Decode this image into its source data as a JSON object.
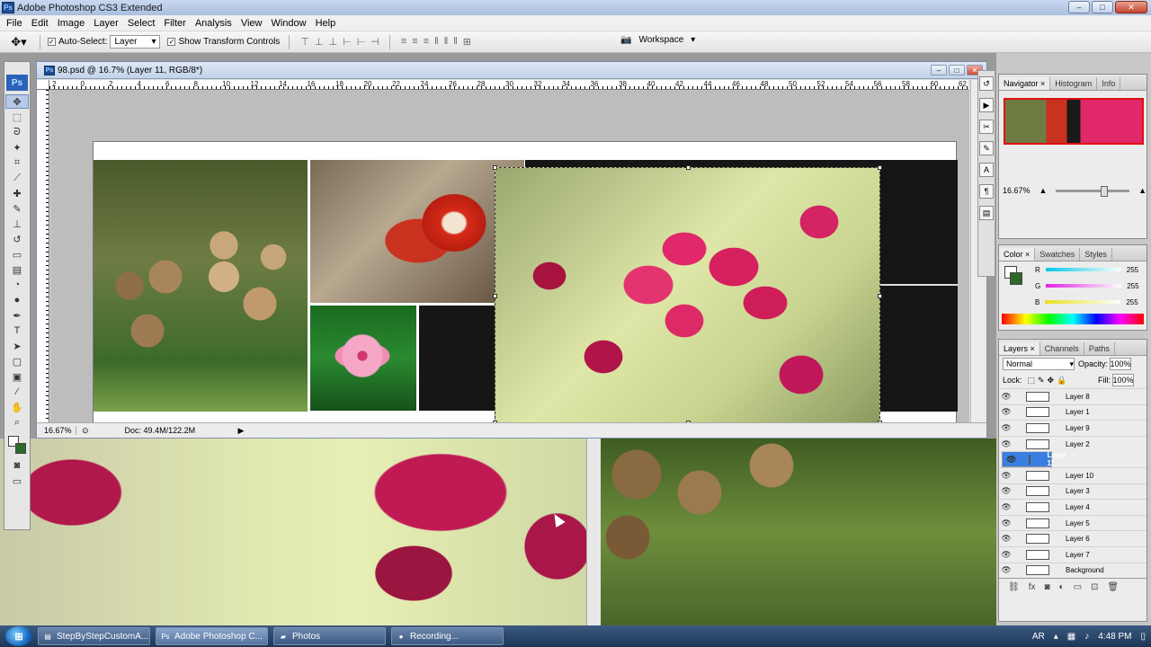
{
  "app": {
    "title": "Adobe Photoshop CS3 Extended",
    "logo": "Ps"
  },
  "menu": [
    "File",
    "Edit",
    "Image",
    "Layer",
    "Select",
    "Filter",
    "Analysis",
    "View",
    "Window",
    "Help"
  ],
  "options": {
    "auto_select_label": "Auto-Select:",
    "auto_select_checked": true,
    "auto_select_value": "Layer",
    "show_transform_label": "Show Transform Controls",
    "show_transform_checked": true,
    "workspace_label": "Workspace"
  },
  "document": {
    "title": "98.psd @ 16.7% (Layer 11, RGB/8*)",
    "zoom": "16.67%",
    "doc_info": "Doc: 49.4M/122.2M",
    "ruler_labels": [
      "2",
      "0",
      "2",
      "4",
      "6",
      "8",
      "10",
      "12",
      "14",
      "16",
      "18",
      "20",
      "22",
      "24",
      "26",
      "28",
      "30",
      "32",
      "34",
      "36",
      "38",
      "40",
      "42",
      "44",
      "46",
      "48",
      "50",
      "52",
      "54",
      "56",
      "58",
      "60",
      "62"
    ]
  },
  "navigator": {
    "tabs": [
      "Navigator",
      "Histogram",
      "Info"
    ],
    "zoom": "16.67%"
  },
  "color_panel": {
    "tabs": [
      "Color",
      "Swatches",
      "Styles"
    ],
    "channels": [
      {
        "label": "R",
        "value": "255",
        "color": "#00c8e8"
      },
      {
        "label": "G",
        "value": "255",
        "color": "#e020e0"
      },
      {
        "label": "B",
        "value": "255",
        "color": "#e8e020"
      }
    ]
  },
  "layers_panel": {
    "tabs": [
      "Layers",
      "Channels",
      "Paths"
    ],
    "blend_mode": "Normal",
    "opacity_label": "Opacity:",
    "opacity": "100%",
    "lock_label": "Lock:",
    "fill_label": "Fill:",
    "fill": "100%",
    "layers": [
      {
        "name": "Layer 8",
        "selected": false
      },
      {
        "name": "Layer 1",
        "selected": false
      },
      {
        "name": "Layer 9",
        "selected": false
      },
      {
        "name": "Layer 2",
        "selected": false
      },
      {
        "name": "Layer 11",
        "selected": true
      },
      {
        "name": "Layer 10",
        "selected": false
      },
      {
        "name": "Layer 3",
        "selected": false
      },
      {
        "name": "Layer 4",
        "selected": false
      },
      {
        "name": "Layer 5",
        "selected": false
      },
      {
        "name": "Layer 6",
        "selected": false
      },
      {
        "name": "Layer 7",
        "selected": false
      },
      {
        "name": "Background",
        "selected": false
      }
    ]
  },
  "taskbar": {
    "tasks": [
      {
        "label": "StepByStepCustomA...",
        "icon": "document-icon"
      },
      {
        "label": "Adobe Photoshop C...",
        "icon": "photoshop-icon"
      },
      {
        "label": "Photos",
        "icon": "folder-icon"
      },
      {
        "label": "Recording...",
        "icon": "record-icon"
      }
    ],
    "language": "AR",
    "time": "4:48 PM"
  },
  "colors": {
    "accent": "#3a7fe0",
    "selection": "#3a7fe0"
  }
}
